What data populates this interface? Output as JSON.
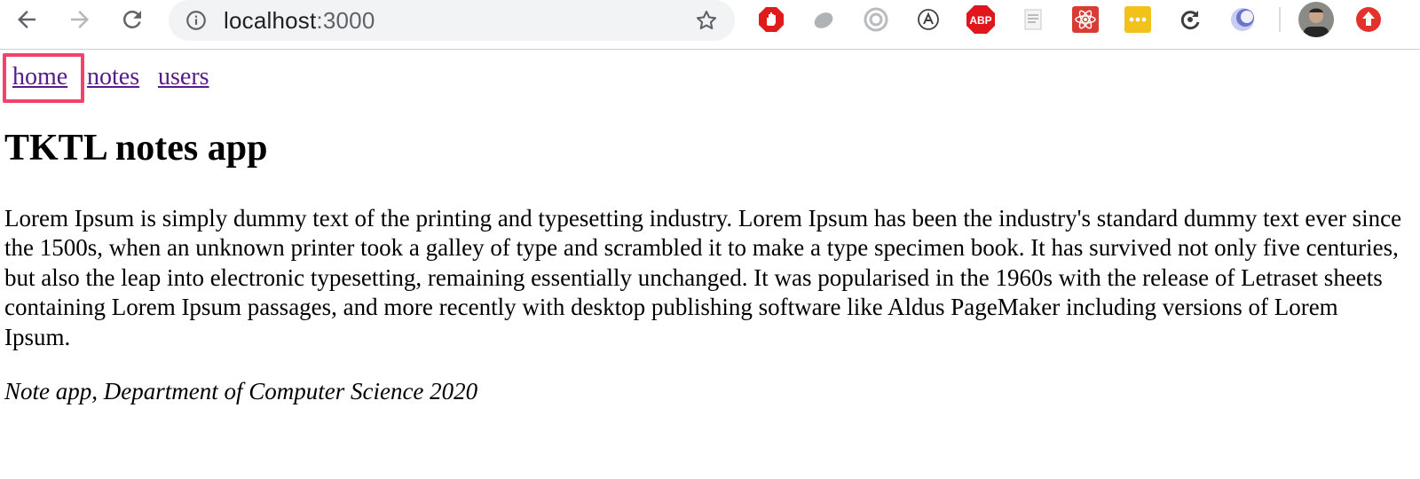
{
  "browser": {
    "url_host": "localhost",
    "url_port": ":3000",
    "extensions": [
      "stop-hand-icon",
      "leaf-icon",
      "target-icon",
      "a-circle-icon",
      "abp-icon",
      "doc-icon",
      "atom-icon",
      "dots-icon",
      "sync-icon",
      "moon-icon",
      "avatar",
      "update-arrow-icon"
    ],
    "abp_label": "ABP",
    "colors": {
      "toolbar_bg": "#ffffff",
      "omnibox_bg": "#f1f3f4",
      "focus_ring": "#f2426e",
      "link": "#551a8b"
    }
  },
  "nav": {
    "home": "home",
    "notes": "notes",
    "users": "users"
  },
  "page": {
    "title": "TKTL notes app",
    "body": "Lorem Ipsum is simply dummy text of the printing and typesetting industry. Lorem Ipsum has been the industry's standard dummy text ever since the 1500s, when an unknown printer took a galley of type and scrambled it to make a type specimen book. It has survived not only five centuries, but also the leap into electronic typesetting, remaining essentially unchanged. It was popularised in the 1960s with the release of Letraset sheets containing Lorem Ipsum passages, and more recently with desktop publishing software like Aldus PageMaker including versions of Lorem Ipsum.",
    "footer": "Note app, Department of Computer Science 2020"
  }
}
